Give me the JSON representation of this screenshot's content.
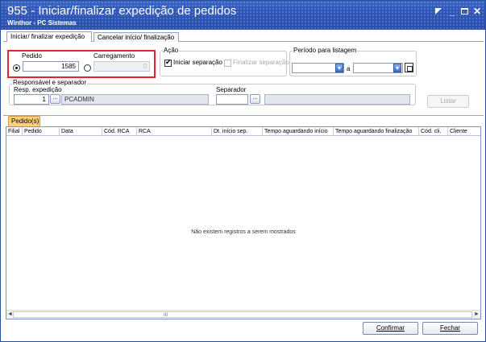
{
  "window": {
    "title": "955 - Iniciar/finalizar expedição de pedidos",
    "subtitle": "Winthor - PC Sistemas"
  },
  "tabs": [
    {
      "label": "Iniciar/ finalizar expedição",
      "active": true
    },
    {
      "label": "Cancelar início/ finalização",
      "active": false
    }
  ],
  "filter": {
    "pedido_label": "Pedido",
    "pedido_value": "1585",
    "carregamento_label": "Carregamento",
    "carregamento_value": "0",
    "selected_radio": "pedido"
  },
  "acao": {
    "label": "Ação",
    "iniciar_label": "Iniciar separação",
    "iniciar_checked": true,
    "finalizar_label": "Finalizar separação",
    "finalizar_checked": false
  },
  "periodo": {
    "label": "Período para listagem",
    "start": "",
    "separator": "a",
    "end": ""
  },
  "responsavel": {
    "group_label": "Responsável e separador",
    "resp_label": "Resp. expedição",
    "resp_code": "1",
    "resp_name": "PCADMIN",
    "sep_label": "Separador",
    "sep_code": "",
    "sep_name": "",
    "browse": "..."
  },
  "listar_label": "Listar",
  "pedidos_tab": "Pedido(s)",
  "grid": {
    "columns": [
      "Filial",
      "Pedido",
      "Data",
      "Cód. RCA",
      "RCA",
      "Dt. início sep.",
      "Tempo aguardando  início",
      "Tempo aguardando finalização",
      "Cód. cli.",
      "Cliente"
    ],
    "empty_message": "Não existem registros a serem mostrados",
    "scroll_left": "◄",
    "scroll_right": "►",
    "scroll_grip": "III"
  },
  "buttons": {
    "confirmar": "Confirmar",
    "fechar": "Fechar"
  },
  "colors": {
    "titlebar": "#2f58b8",
    "highlight_box": "#e0262c",
    "active_tab": "#ffcf7e"
  }
}
